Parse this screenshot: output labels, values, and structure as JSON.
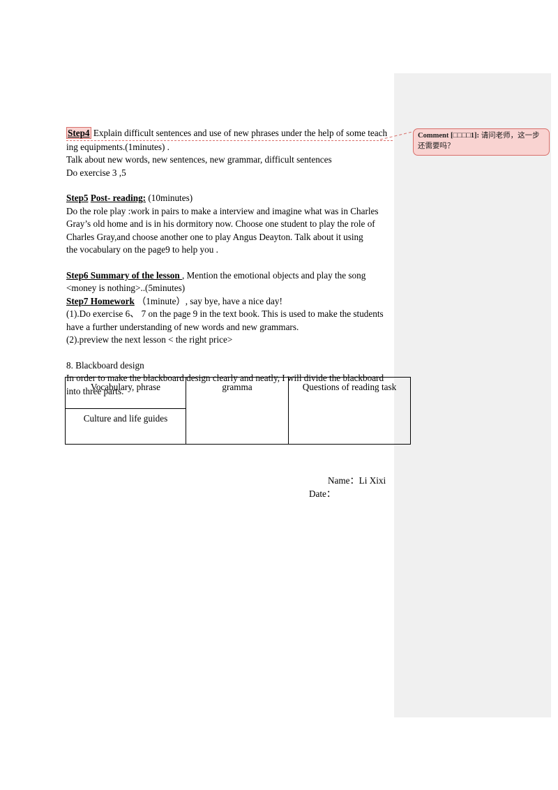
{
  "document": {
    "step4": {
      "chip_label": "Step4",
      "revised_line1": " Explain difficult sentences and use of new phrases under the help of some teach",
      "line2": "ing equipments.(1minutes) .",
      "line3": "Talk about new words, new sentences, new grammar, difficult sentences",
      "line4": "Do exercise 3 ,5"
    },
    "step5": {
      "heading_step": "Step5",
      "heading_title": "Post- reading:",
      "duration": "(10minutes)",
      "lines": [
        "Do the role play :work in pairs to make a interview and imagine what was in Charles",
        "Gray’s old home and is in his dormitory now. Choose one student to play the role of",
        "Charles Gray,and    choose another one to play Angus Deayton. Talk about it using",
        "the vocabulary on the page9 to help you ."
      ]
    },
    "step6": {
      "heading": "Step6 Summary of the lesson ",
      "tail": ", Mention the emotional objects and play the song",
      "line2": "<money is nothing>..(5minutes)"
    },
    "step7": {
      "heading": "Step7 Homework",
      "tail": "（1minute）, say bye, have a nice day!",
      "items": [
        "(1).Do exercise 6、 7 on the page 9 in the text book. This is used to make the students",
        " have a further understanding of new words and new grammars.",
        "(2).preview the next lesson < the right price>"
      ]
    },
    "blackboard": {
      "heading": "8. Blackboard design",
      "intro_line1": "In order to make the blackboard design clearly and neatly, I will divide the blackboard",
      "intro_line2": " into three parts.",
      "table": {
        "cell_vocabulary": "Vocabulary, phrase",
        "cell_culture": "Culture and life guides",
        "cell_gramma": "gramma",
        "cell_questions": "Questions of reading task"
      }
    },
    "signature": {
      "name_line": "Name：Li  Xixi",
      "date_line": "Date："
    }
  },
  "comment": {
    "tag": "Comment [□□□□1]:",
    "body": " 请问老师，这一步还需要吗？"
  },
  "colors": {
    "margin_panel": "#f0f0f0",
    "comment_fill": "#f9d3d1",
    "comment_border": "#d86f6a",
    "text": "#000000"
  }
}
